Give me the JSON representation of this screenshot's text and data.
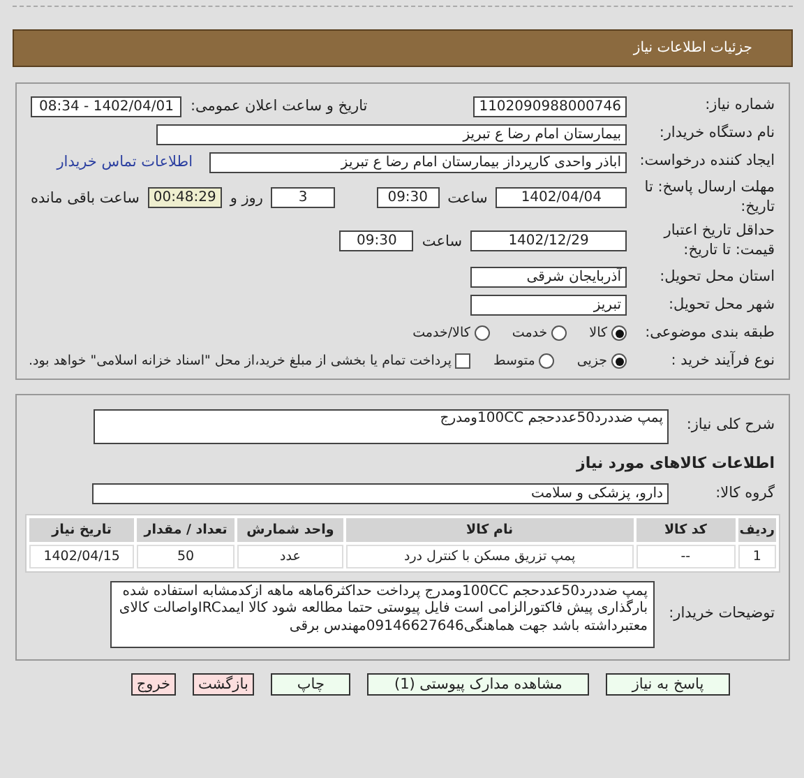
{
  "header": {
    "title": "جزئیات اطلاعات نیاز"
  },
  "need_number": {
    "label": "شماره نیاز:",
    "value": "1102090988000746"
  },
  "announce": {
    "label": "تاریخ و ساعت اعلان عمومی:",
    "value": "1402/04/01 - 08:34"
  },
  "buyer_org": {
    "label": "نام دستگاه خریدار:",
    "value": "بیمارستان امام رضا  ع  تبریز"
  },
  "requester": {
    "label": "ایجاد کننده درخواست:",
    "value": "اباذر واحدی کارپرداز بیمارستان امام رضا  ع  تبریز",
    "link": "اطلاعات تماس خریدار"
  },
  "deadline": {
    "label": "مهلت ارسال پاسخ: تا تاریخ:",
    "date": "1402/04/04",
    "time_label": "ساعت",
    "time": "09:30",
    "days": "3",
    "days_label": "روز و",
    "remaining": "00:48:29",
    "remaining_label": "ساعت باقی مانده"
  },
  "validity": {
    "label": "حداقل تاریخ اعتبار قیمت: تا تاریخ:",
    "date": "1402/12/29",
    "time_label": "ساعت",
    "time": "09:30"
  },
  "province": {
    "label": "استان محل تحویل:",
    "value": "آذربایجان شرقی"
  },
  "city": {
    "label": "شهر محل تحویل:",
    "value": "تبریز"
  },
  "category": {
    "label": "طبقه بندی موضوعی:",
    "options": [
      {
        "label": "کالا",
        "selected": true
      },
      {
        "label": "خدمت",
        "selected": false
      },
      {
        "label": "کالا/خدمت",
        "selected": false
      }
    ]
  },
  "process": {
    "label": "نوع فرآیند خرید :",
    "options": [
      {
        "label": "جزیی",
        "selected": true
      },
      {
        "label": "متوسط",
        "selected": false
      }
    ],
    "payment": {
      "label": "پرداخت تمام یا بخشی از مبلغ خرید،از محل \"اسناد خزانه اسلامی\" خواهد بود.",
      "checked": false
    }
  },
  "summary": {
    "label": "شرح کلی نیاز:",
    "value": "پمپ ضددرد50عددحجم 100CCومدرج"
  },
  "goods_heading": "اطلاعات کالاهای مورد نیاز",
  "goods_group": {
    "label": "گروه کالا:",
    "value": "دارو، پزشکی و سلامت"
  },
  "table": {
    "columns": [
      "ردیف",
      "کد کالا",
      "نام کالا",
      "واحد شمارش",
      "تعداد / مقدار",
      "تاریخ نیاز"
    ],
    "rows": [
      [
        "1",
        "--",
        "پمپ تزریق مسکن با کنترل درد",
        "عدد",
        "50",
        "1402/04/15"
      ]
    ]
  },
  "buyer_notes": {
    "label": "توضیحات خریدار:",
    "value": "پمپ ضددرد50عددحجم 100CCومدرج پرداخت حداکثر6ماهه ماهه ازکدمشابه استفاده شده بارگذاری پیش فاکتورالزامی است فایل پیوستی حتما مطالعه شود کالا ایمدIRCواصالت کالای معتبرداشته باشد جهت هماهنگی09146627646مهندس برقی"
  },
  "buttons": [
    {
      "label": "پاسخ به نیاز",
      "kind": "normal"
    },
    {
      "label": "مشاهده مدارک پیوستی (1)",
      "kind": "normal"
    },
    {
      "label": "چاپ",
      "kind": "normal"
    },
    {
      "label": "بازگشت",
      "kind": "exit"
    },
    {
      "label": "خروج",
      "kind": "exit"
    }
  ]
}
